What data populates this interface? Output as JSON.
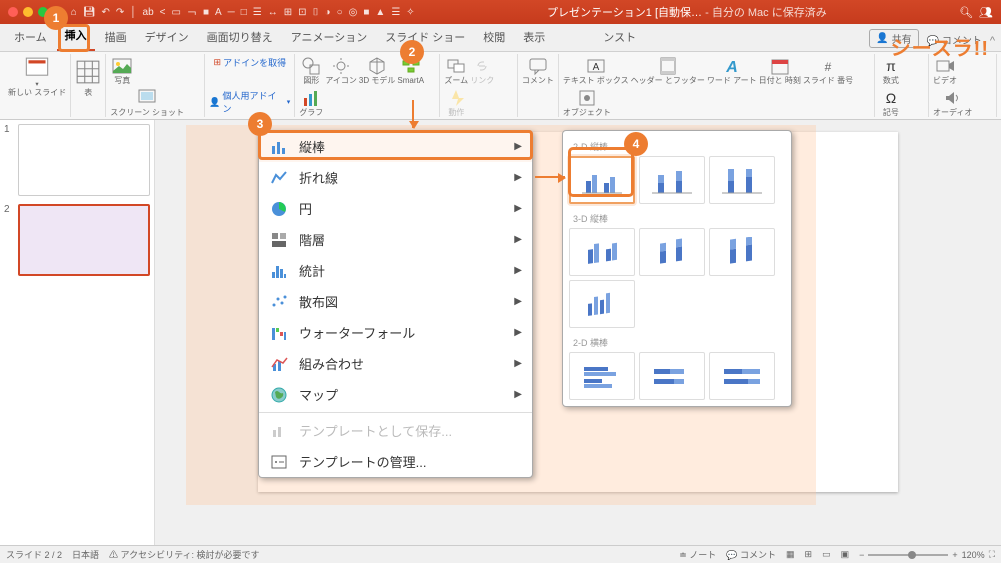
{
  "brand": "シースラ!!",
  "titlebar": {
    "doc_name": "プレゼンテーション1 [自動保…",
    "save_status": "- 自分の Mac に保存済み"
  },
  "tabs": {
    "home": "ホーム",
    "insert": "挿入",
    "draw": "描画",
    "design": "デザイン",
    "transitions": "画面切り替え",
    "animations": "アニメーション",
    "slideshow": "スライド ショー",
    "review": "校閲",
    "view": "表示",
    "nst": "ンスト",
    "share": "共有",
    "comments": "コメント"
  },
  "ribbon": {
    "new_slide": "新しい\nスライド",
    "table": "表",
    "picture": "写真",
    "screenshot": "スクリーン\nショット",
    "get_addins": "アドインを取得",
    "my_addins": "個人用アドイン",
    "shapes": "図形",
    "icons": "アイコン",
    "model3d": "3D\nモデル",
    "smartart": "SmartA",
    "chart": "グラフ",
    "zoom": "ズーム",
    "link": "リンク",
    "action": "動作",
    "comment": "コメント",
    "textbox": "テキスト\nボックス",
    "header": "ヘッダー\nとフッター",
    "wordart": "ワード\nアート",
    "datetime": "日付と\n時刻",
    "slidenum": "スライド\n番号",
    "object": "オブジェクト",
    "equation": "数式",
    "symbol": "記号",
    "video": "ビデオ",
    "audio": "オーディオ"
  },
  "thumbs": {
    "n1": "1",
    "n2": "2"
  },
  "chart_menu": {
    "column": "縦棒",
    "line": "折れ線",
    "pie": "円",
    "hierarchy": "階層",
    "statistics": "統計",
    "scatter": "散布図",
    "waterfall": "ウォーターフォール",
    "combo": "組み合わせ",
    "map": "マップ",
    "save_template": "テンプレートとして保存...",
    "manage_templates": "テンプレートの管理..."
  },
  "submenu": {
    "h2d_col": "2-D 縦棒",
    "h3d_col": "3-D 縦棒",
    "h2d_bar": "2-D 横棒"
  },
  "status": {
    "slide": "スライド 2 / 2",
    "lang": "日本語",
    "a11y": "アクセシビリティ: 検討が必要です",
    "notes": "ノート",
    "comments_btn": "コメント",
    "zoom": "120%"
  },
  "callouts": {
    "c1": "1",
    "c2": "2",
    "c3": "3",
    "c4": "4"
  }
}
